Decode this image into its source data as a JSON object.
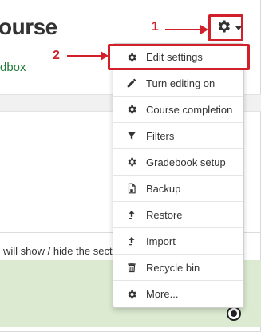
{
  "page": {
    "title": "ourse",
    "link": "dbox",
    "section_help": "will show / hide the section"
  },
  "annotations": {
    "step1": "1",
    "step2": "2",
    "accent": "#d2202b"
  },
  "settings_menu": {
    "trigger_icon": "gear-icon",
    "items": [
      {
        "label": "Edit settings",
        "icon": "gear-icon"
      },
      {
        "label": "Turn editing on",
        "icon": "pencil-icon"
      },
      {
        "label": "Course completion",
        "icon": "gear-icon"
      },
      {
        "label": "Filters",
        "icon": "filter-icon"
      },
      {
        "label": "Gradebook setup",
        "icon": "gear-icon"
      },
      {
        "label": "Backup",
        "icon": "file-icon"
      },
      {
        "label": "Restore",
        "icon": "upload-icon"
      },
      {
        "label": "Import",
        "icon": "upload-icon"
      },
      {
        "label": "Recycle bin",
        "icon": "trash-icon"
      },
      {
        "label": "More...",
        "icon": "gear-icon"
      }
    ]
  },
  "colors": {
    "link": "#1f7a3a",
    "highlight_section": "#dbead1"
  }
}
